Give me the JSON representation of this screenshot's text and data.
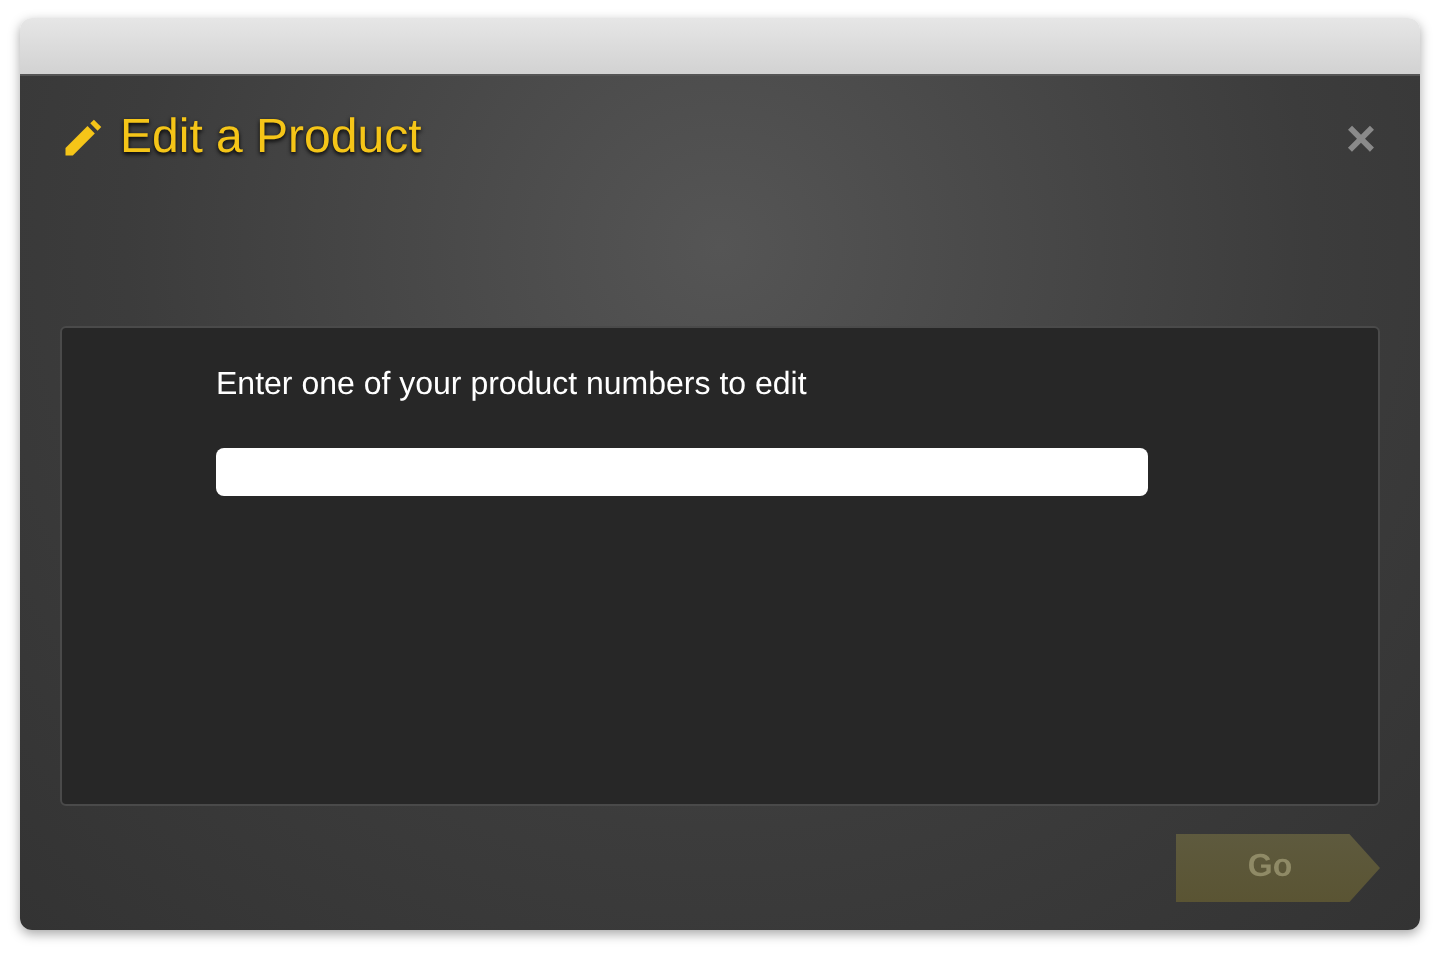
{
  "dialog": {
    "title": "Edit a Product",
    "close": "×"
  },
  "form": {
    "label": "Enter one of your product numbers to edit"
  },
  "go_button": {
    "label": "Go",
    "disabled": true
  }
}
